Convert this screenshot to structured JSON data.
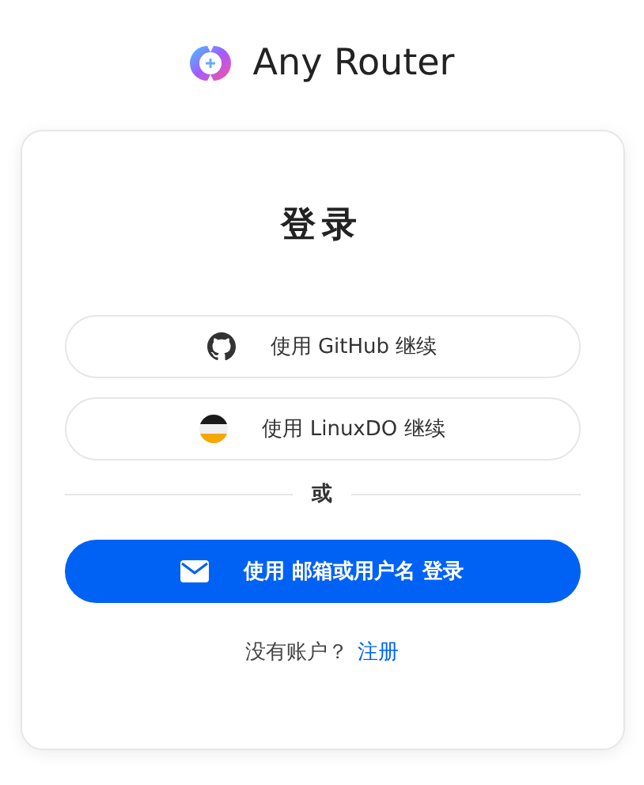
{
  "brand": {
    "name": "Any Router"
  },
  "card": {
    "title": "登录",
    "buttons": [
      {
        "kind": "github",
        "label": "使用 GitHub 继续"
      },
      {
        "kind": "linuxdo",
        "label": "使用 LinuxDO 继续"
      }
    ],
    "divider": "或",
    "primary": {
      "kind": "email",
      "label": "使用 邮箱或用户名 登录"
    },
    "footer": {
      "text": "没有账户？",
      "link": "注册"
    }
  }
}
